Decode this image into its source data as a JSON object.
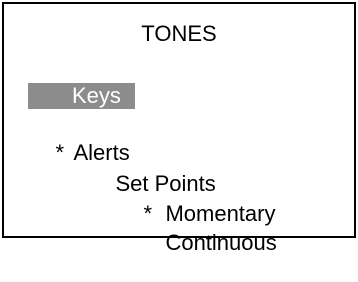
{
  "screen": {
    "title": "TONES",
    "menu": [
      {
        "label": "Keys",
        "marker": "",
        "selected": true
      },
      {
        "label": "Alerts",
        "marker": "*",
        "selected": false
      },
      {
        "label": "Set Points",
        "marker": "",
        "selected": false
      },
      {
        "label": "Momentary",
        "marker": "*",
        "selected": false
      },
      {
        "label": "Continuous",
        "marker": "",
        "selected": false
      }
    ],
    "colors": {
      "highlight": "#8c8c8c",
      "foreground": "#000000",
      "background": "#ffffff"
    }
  }
}
